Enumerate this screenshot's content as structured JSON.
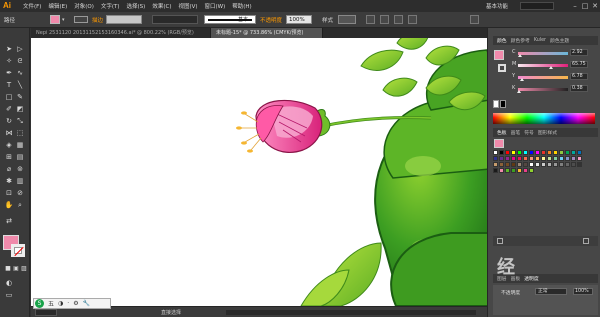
{
  "app": {
    "logo": "Ai",
    "menu": [
      "文件(F)",
      "编辑(E)",
      "对象(O)",
      "文字(T)",
      "选择(S)",
      "效果(C)",
      "视图(V)",
      "窗口(W)",
      "帮助(H)"
    ],
    "workspace": "基本功能",
    "window_controls": [
      "–",
      "□",
      "✕"
    ]
  },
  "control_bar": {
    "label": "路径",
    "stroke_label": "描边",
    "stroke_weight": "",
    "profile_label": "等比",
    "brush": "基本",
    "opacity_label": "不透明度",
    "opacity": "100%",
    "style_label": "样式"
  },
  "tabs": [
    {
      "label": "Nepi 2531120 20131152153160346.ai* @ 800.22% (RGB/预览)",
      "active": false
    },
    {
      "label": "未标题-15* @ 733.86% (CMYK/预览)",
      "active": true
    }
  ],
  "color_panel": {
    "tabs": [
      "颜色",
      "颜色参考",
      "Kuler",
      "颜色主题"
    ],
    "sliders": [
      {
        "letter": "C",
        "value": "2.92",
        "fraction": 0.03
      },
      {
        "letter": "M",
        "value": "65.75",
        "fraction": 0.66
      },
      {
        "letter": "Y",
        "value": "6.78",
        "fraction": 0.07
      },
      {
        "letter": "K",
        "value": "0.38",
        "fraction": 0.01
      }
    ]
  },
  "swatches_panel": {
    "tabs": [
      "色板",
      "画笔",
      "符号",
      "图形样式"
    ]
  },
  "layers_panel": {
    "tabs": [
      "图层",
      "画板",
      "透明度"
    ],
    "blend_mode": "正常",
    "opacity_label": "不透明度",
    "opacity": "100%"
  },
  "status_bar": {
    "zoom": "",
    "text": "直接选择"
  },
  "ime": {
    "chars": [
      "五",
      "◑",
      "·",
      "⚙",
      "🔧"
    ]
  },
  "watermark": "经",
  "colors": {
    "fill": "#f08aab",
    "accent": "#ff9a00",
    "leaf_dark": "#2e8a1f",
    "leaf_light": "#8fd12f",
    "petal": "#ea3f8a"
  }
}
